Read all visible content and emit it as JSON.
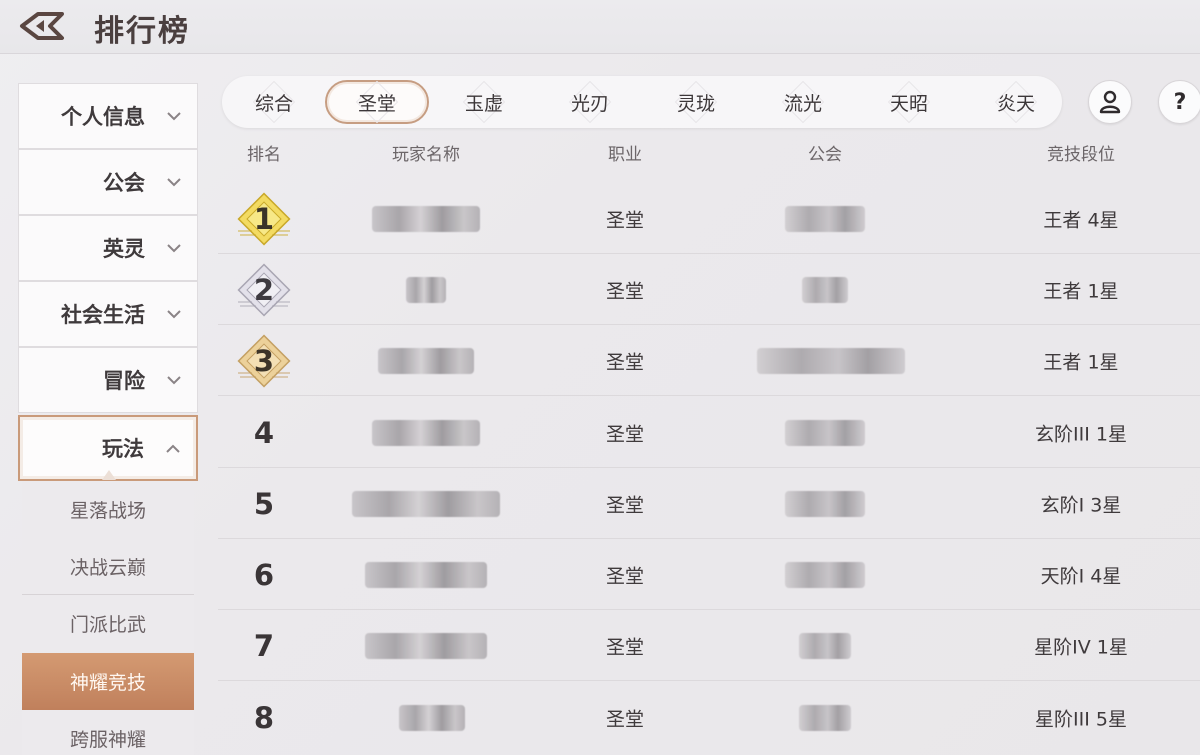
{
  "header": {
    "title": "排行榜",
    "back_icon": "back-arrow-icon"
  },
  "sidebar": {
    "items": [
      {
        "label": "个人信息",
        "expanded": false
      },
      {
        "label": "公会",
        "expanded": false
      },
      {
        "label": "英灵",
        "expanded": false
      },
      {
        "label": "社会生活",
        "expanded": false
      },
      {
        "label": "冒险",
        "expanded": false
      },
      {
        "label": "玩法",
        "expanded": true
      }
    ],
    "subitems": [
      {
        "label": "星落战场",
        "selected": false
      },
      {
        "label": "决战云巅",
        "selected": false
      },
      {
        "label": "门派比武",
        "selected": false
      },
      {
        "label": "神耀竞技",
        "selected": true
      },
      {
        "label": "跨服神耀",
        "selected": false
      }
    ]
  },
  "tabs": [
    {
      "label": "综合",
      "selected": false
    },
    {
      "label": "圣堂",
      "selected": true
    },
    {
      "label": "玉虚",
      "selected": false
    },
    {
      "label": "光刃",
      "selected": false
    },
    {
      "label": "灵珑",
      "selected": false
    },
    {
      "label": "流光",
      "selected": false
    },
    {
      "label": "天昭",
      "selected": false
    },
    {
      "label": "炎天",
      "selected": false
    }
  ],
  "top_buttons": {
    "profile_icon": "person-icon",
    "help_label": "?"
  },
  "table": {
    "headers": {
      "rank": "排名",
      "player": "玩家名称",
      "class": "职业",
      "guild": "公会",
      "tier": "竞技段位"
    },
    "rows": [
      {
        "rank": "1",
        "medal": "gold",
        "player": "[blurred]",
        "class": "圣堂",
        "guild": "[blurred]",
        "tier": "王者 4星"
      },
      {
        "rank": "2",
        "medal": "silver",
        "player": "[blurred]",
        "class": "圣堂",
        "guild": "[blurred]",
        "tier": "王者 1星"
      },
      {
        "rank": "3",
        "medal": "bronze",
        "player": "[blurred]",
        "class": "圣堂",
        "guild": "[blurred]",
        "tier": "王者 1星"
      },
      {
        "rank": "4",
        "medal": "",
        "player": "[blurred]",
        "class": "圣堂",
        "guild": "[blurred]",
        "tier": "玄阶III 1星"
      },
      {
        "rank": "5",
        "medal": "",
        "player": "[blurred]",
        "class": "圣堂",
        "guild": "[blurred]",
        "tier": "玄阶I 3星"
      },
      {
        "rank": "6",
        "medal": "",
        "player": "[blurred]",
        "class": "圣堂",
        "guild": "[blurred]",
        "tier": "天阶I 4星"
      },
      {
        "rank": "7",
        "medal": "",
        "player": "[blurred]",
        "class": "圣堂",
        "guild": "[blurred]",
        "tier": "星阶IV 1星"
      },
      {
        "rank": "8",
        "medal": "",
        "player": "[blurred]",
        "class": "圣堂",
        "guild": "[blurred]",
        "tier": "星阶III 5星"
      }
    ]
  },
  "colors": {
    "accent": "#c69d82",
    "selected_subitem": "#c8875f",
    "gold_medal": "#f2d65a",
    "silver_medal": "#d9d7e0",
    "bronze_medal": "#e8c98e"
  }
}
